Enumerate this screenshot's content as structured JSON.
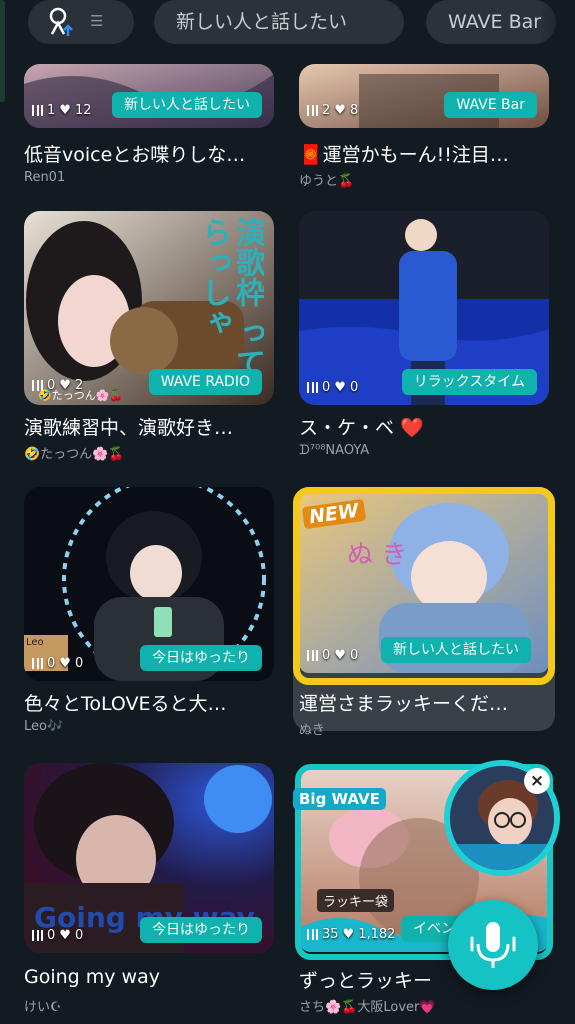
{
  "top_bar": {
    "tags": [
      "新しい人と話したい",
      "WAVE Bar"
    ]
  },
  "cards": [
    {
      "listeners": "1",
      "likes": "12",
      "badge": "新しい人と話したい",
      "title": "低音voiceとお喋りしな…",
      "owner": "Ren01"
    },
    {
      "listeners": "2",
      "likes": "8",
      "badge": "WAVE Bar",
      "title": "🧧運営かもーん!!注目…",
      "owner": "ゆうと🍒"
    },
    {
      "listeners": "0",
      "likes": "2",
      "badge": "WAVE RADIO",
      "title": "演歌練習中、演歌好き…",
      "owner": "🤣たっつん🌸🍒",
      "thumb_text": "演歌枠 ってらっしゃ",
      "thumb_owner": "🤣たっつん🌸🍒"
    },
    {
      "listeners": "0",
      "likes": "0",
      "badge": "リラックスタイム",
      "title": "ス・ケ・ベ ❤️",
      "owner": "ᗪ⁷⁰⁸NAOYA"
    },
    {
      "listeners": "0",
      "likes": "0",
      "badge": "今日はゆったり",
      "title": "色々とToLOVEると大…",
      "owner": "Leo🎶",
      "thumb_text": "Leo"
    },
    {
      "listeners": "0",
      "likes": "0",
      "badge": "新しい人と話したい",
      "title": "運営さまラッキーくだ…",
      "owner": "ぬき",
      "tag": "NEW"
    },
    {
      "listeners": "0",
      "likes": "0",
      "badge": "今日はゆったり",
      "title": "Going my way",
      "owner": "けい☪︎",
      "thumb_text": "Going my way"
    },
    {
      "listeners": "35",
      "likes": "1,182",
      "badge": "イベントガチ",
      "title": "ずっとラッキー",
      "owner": "さち🌸🍒大阪Lover💗",
      "tag": "Big WAVE",
      "lucky": "ラッキー袋"
    }
  ],
  "floating": {
    "close": "×"
  },
  "colors": {
    "background": "#131b22",
    "accent": "#10b2ad",
    "gold": "#f5c91a"
  }
}
